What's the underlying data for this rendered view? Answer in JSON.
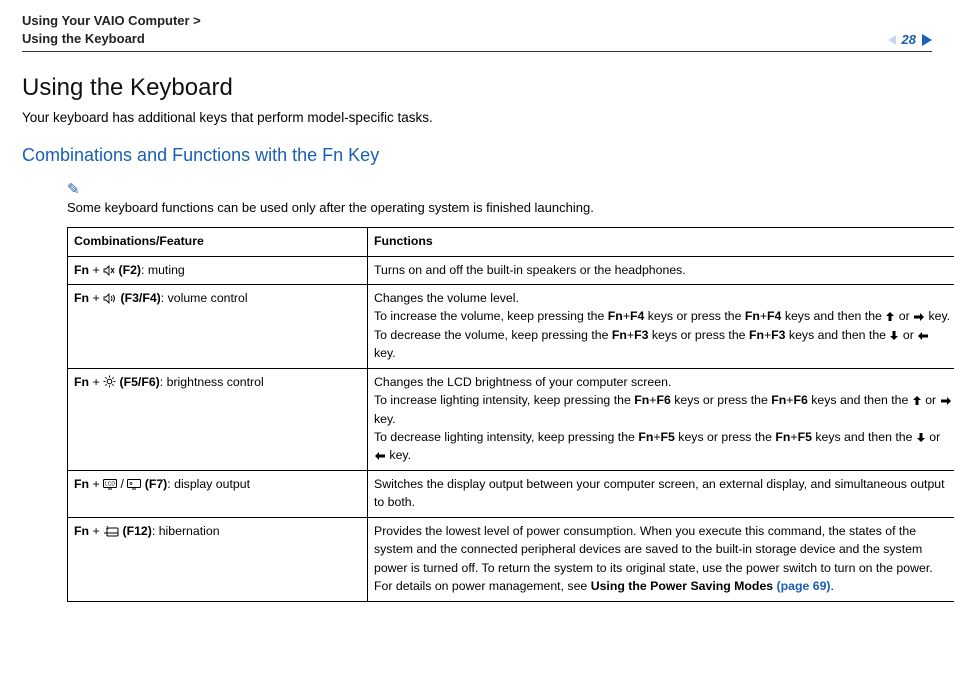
{
  "header": {
    "breadcrumb_line1": "Using Your VAIO Computer >",
    "breadcrumb_line2": "Using the Keyboard",
    "page_number": "28"
  },
  "title": "Using the Keyboard",
  "intro": "Your keyboard has additional keys that perform model-specific tasks.",
  "section_heading": "Combinations and Functions with the Fn Key",
  "note": "Some keyboard functions can be used only after the operating system is finished launching.",
  "table": {
    "header_combo": "Combinations/Feature",
    "header_func": "Functions",
    "rows": [
      {
        "fn": "Fn",
        "keys": "(F2)",
        "label": ": muting",
        "func_html": "Turns on and off the built-in speakers or the headphones."
      },
      {
        "fn": "Fn",
        "keys": "(F3/F4)",
        "label": ": volume control",
        "f_line1": "Changes the volume level.",
        "f_line2a": "To increase the volume, keep pressing the ",
        "f_line2b": " keys or press the ",
        "f_line2c": " keys and then the ",
        "f_k1": "Fn",
        "f_k1p": "+",
        "f_k1b": "F4",
        "f_line2d": " or ",
        "f_line2e": " key.",
        "f_line3a": "To decrease the volume, keep pressing the ",
        "f_k2": "Fn",
        "f_k2p": "+",
        "f_k2b": "F3",
        "f_line3c": " keys or press the ",
        "f_line3d": " keys and then the ",
        "f_line3e": " or ",
        "f_line3f": " key."
      },
      {
        "fn": "Fn",
        "keys": "(F5/F6)",
        "label": ": brightness control",
        "f_line1": "Changes the LCD brightness of your computer screen.",
        "f_line2a": "To increase lighting intensity, keep pressing the ",
        "f_k1": "Fn",
        "f_k1p": "+",
        "f_k1b": "F6",
        "f_line2b": " keys or press the ",
        "f_line2c": " keys and then the ",
        "f_line2d": " or ",
        "f_line2e": " key.",
        "f_line3a": "To decrease lighting intensity, keep pressing the ",
        "f_k2": "Fn",
        "f_k2p": "+",
        "f_k2b": "F5",
        "f_line3c": " keys or press the ",
        "f_line3d": " keys and then the ",
        "f_line3e": " or ",
        "f_line3f": " key."
      },
      {
        "fn": "Fn",
        "keys": "(F7)",
        "label": ": display output",
        "func_html": "Switches the display output between your computer screen, an external display, and simultaneous output to both."
      },
      {
        "fn": "Fn",
        "keys": "(F12)",
        "label": ": hibernation",
        "f_line1": "Provides the lowest level of power consumption. When you execute this command, the states of the system and the connected peripheral devices are saved to the built-in storage device and the system power is turned off. To return the system to its original state, use the power switch to turn on the power.",
        "f_line2a": "For details on power management, see ",
        "f_link_label": "Using the Power Saving Modes ",
        "f_link_page": "(page 69)",
        "f_line2b": "."
      }
    ]
  }
}
